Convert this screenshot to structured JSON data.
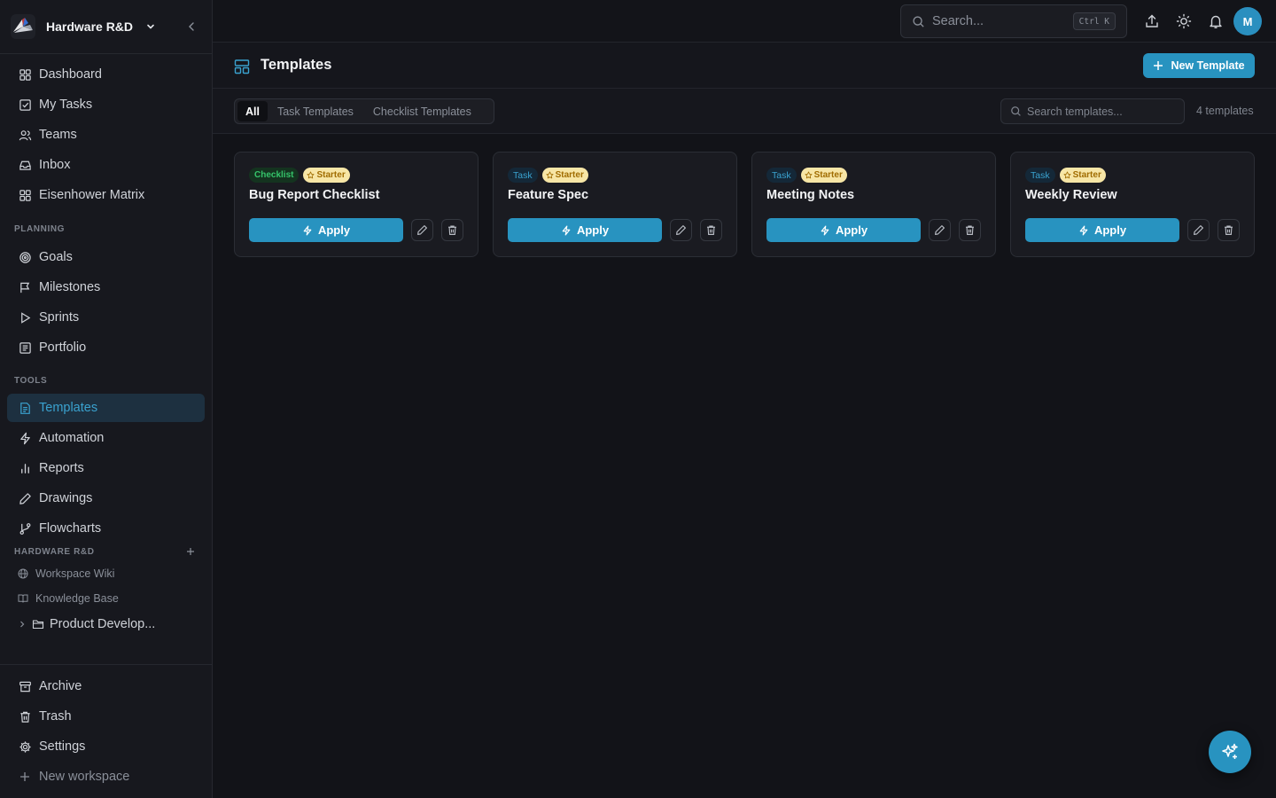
{
  "workspace": {
    "name": "Hardware R&D"
  },
  "nav": {
    "main": [
      {
        "label": "Dashboard",
        "icon": "grid-icon"
      },
      {
        "label": "My Tasks",
        "icon": "check-square-icon"
      },
      {
        "label": "Teams",
        "icon": "users-icon"
      },
      {
        "label": "Inbox",
        "icon": "inbox-icon"
      },
      {
        "label": "Eisenhower Matrix",
        "icon": "grid-icon"
      }
    ],
    "planning_label": "PLANNING",
    "planning": [
      {
        "label": "Goals",
        "icon": "target-icon"
      },
      {
        "label": "Milestones",
        "icon": "flag-icon"
      },
      {
        "label": "Sprints",
        "icon": "play-icon"
      },
      {
        "label": "Portfolio",
        "icon": "portfolio-icon"
      }
    ],
    "tools_label": "TOOLS",
    "tools": [
      {
        "label": "Templates",
        "icon": "template-doc-icon"
      },
      {
        "label": "Automation",
        "icon": "zap-icon"
      },
      {
        "label": "Reports",
        "icon": "bar-chart-icon"
      },
      {
        "label": "Drawings",
        "icon": "pen-icon"
      },
      {
        "label": "Flowcharts",
        "icon": "git-branch-icon"
      }
    ],
    "workspace_label": "HARDWARE R&D",
    "workspace_items": [
      {
        "label": "Workspace Wiki",
        "icon": "globe-icon"
      },
      {
        "label": "Knowledge Base",
        "icon": "book-icon"
      }
    ],
    "folder": {
      "label": "Product Develop...",
      "icon": "folder-icon"
    },
    "bottom": [
      {
        "label": "Archive",
        "icon": "archive-icon"
      },
      {
        "label": "Trash",
        "icon": "trash-icon"
      },
      {
        "label": "Settings",
        "icon": "gear-icon"
      },
      {
        "label": "New workspace",
        "icon": "plus-icon"
      }
    ]
  },
  "topbar": {
    "search_placeholder": "Search...",
    "shortcut": "Ctrl K",
    "avatar_initial": "M"
  },
  "page": {
    "title": "Templates",
    "new_button": "New Template"
  },
  "filters": {
    "tabs": [
      "All",
      "Task Templates",
      "Checklist Templates"
    ],
    "active_tab": "All",
    "search_placeholder": "Search templates...",
    "count_text": "4 templates"
  },
  "templates": [
    {
      "type": "Checklist",
      "badge": "Starter",
      "title": "Bug Report Checklist",
      "apply_label": "Apply"
    },
    {
      "type": "Task",
      "badge": "Starter",
      "title": "Feature Spec",
      "apply_label": "Apply"
    },
    {
      "type": "Task",
      "badge": "Starter",
      "title": "Meeting Notes",
      "apply_label": "Apply"
    },
    {
      "type": "Task",
      "badge": "Starter",
      "title": "Weekly Review",
      "apply_label": "Apply"
    }
  ],
  "colors": {
    "accent": "#2893c0",
    "checklist_badge": "#35c46a",
    "starter_badge": "#f7e6a6",
    "background": "#121318"
  }
}
